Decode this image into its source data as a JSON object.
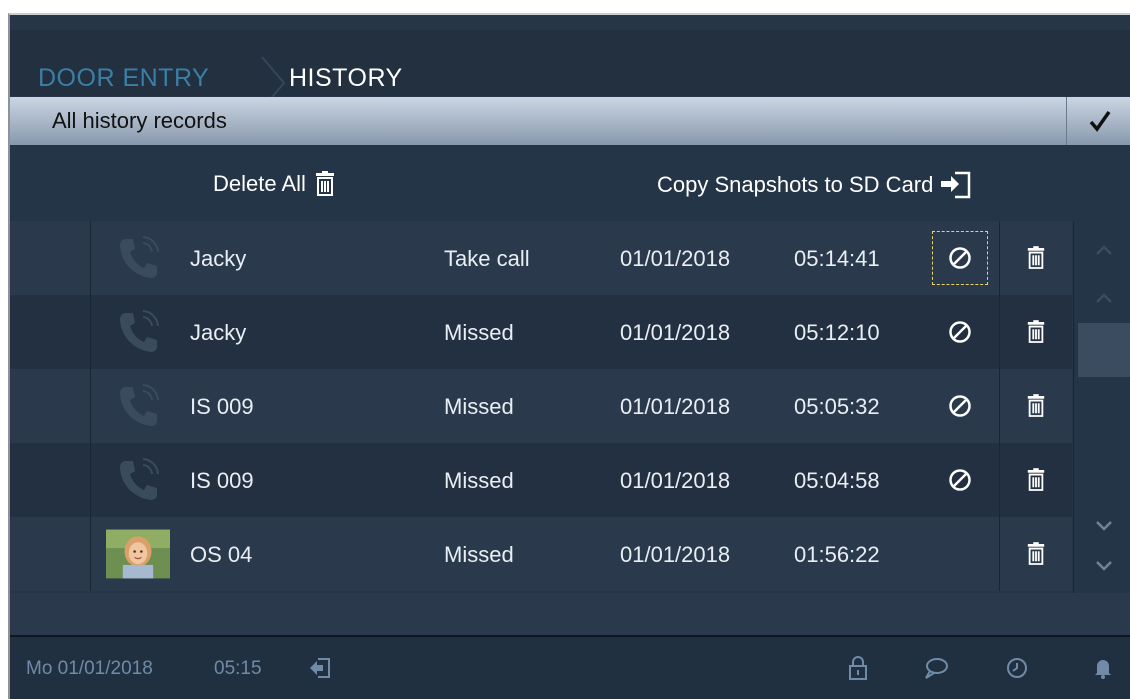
{
  "header": {
    "breadcrumb_home": "DOOR ENTRY",
    "breadcrumb_current": "HISTORY"
  },
  "filter": {
    "label": "All history records"
  },
  "actions": {
    "delete_all_label": "Delete All",
    "copy_snapshots_label": "Copy Snapshots to SD Card"
  },
  "records": [
    {
      "name": "Jacky",
      "status": "Take call",
      "date": "01/01/2018",
      "time": "05:14:41",
      "icon": "phone-icon",
      "snapshot": "no-snapshot-icon"
    },
    {
      "name": "Jacky",
      "status": "Missed",
      "date": "01/01/2018",
      "time": "05:12:10",
      "icon": "phone-icon",
      "snapshot": "no-snapshot-icon"
    },
    {
      "name": "IS 009",
      "status": "Missed",
      "date": "01/01/2018",
      "time": "05:05:32",
      "icon": "phone-icon",
      "snapshot": "no-snapshot-icon"
    },
    {
      "name": "IS 009",
      "status": "Missed",
      "date": "01/01/2018",
      "time": "05:04:58",
      "icon": "phone-icon",
      "snapshot": "no-snapshot-icon"
    },
    {
      "name": "OS 04",
      "status": "Missed",
      "date": "01/01/2018",
      "time": "01:56:22",
      "icon": "visitor-photo",
      "snapshot": ""
    }
  ],
  "statusbar": {
    "date": "Mo 01/01/2018",
    "time": "05:15"
  },
  "colors": {
    "background": "#263648",
    "accent_blue": "#3b7fa7",
    "focus_outline": "#e7d26a"
  }
}
